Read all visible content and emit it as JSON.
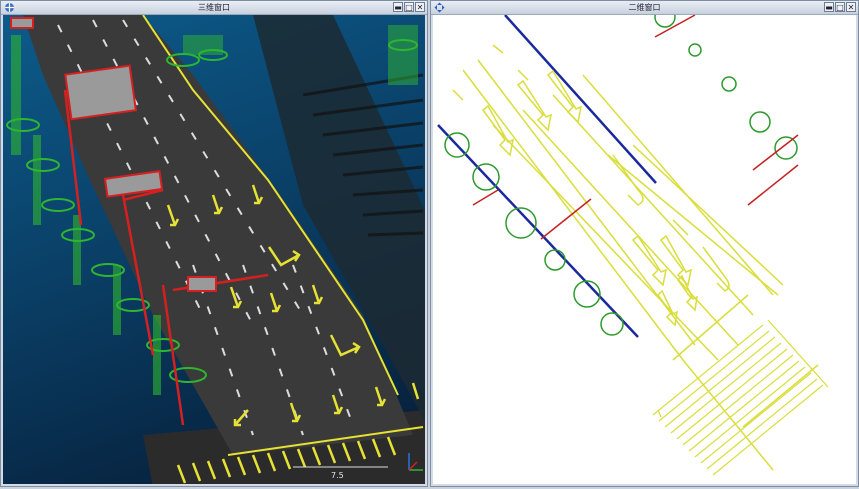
{
  "window_3d": {
    "title": "三维窗口",
    "buttons": [
      "minimize",
      "maximize",
      "close"
    ],
    "scale_value": "7.5",
    "axis_icon": "xyz-axis-icon"
  },
  "window_2d": {
    "title": "二维窗口",
    "buttons": [
      "minimize",
      "maximize",
      "close"
    ],
    "icon": "pan-icon"
  },
  "colors": {
    "road": "#3a3a3a",
    "marking": "#e6e233",
    "vegetation": "#2fb52f",
    "pole": "#d62020",
    "boundary_line": "#1a2a9c",
    "tree_circle": "#2e9a2e",
    "drawing_line": "#d9de3a",
    "background_3d": "#0a3f66",
    "background_2d": "#ffffff"
  }
}
